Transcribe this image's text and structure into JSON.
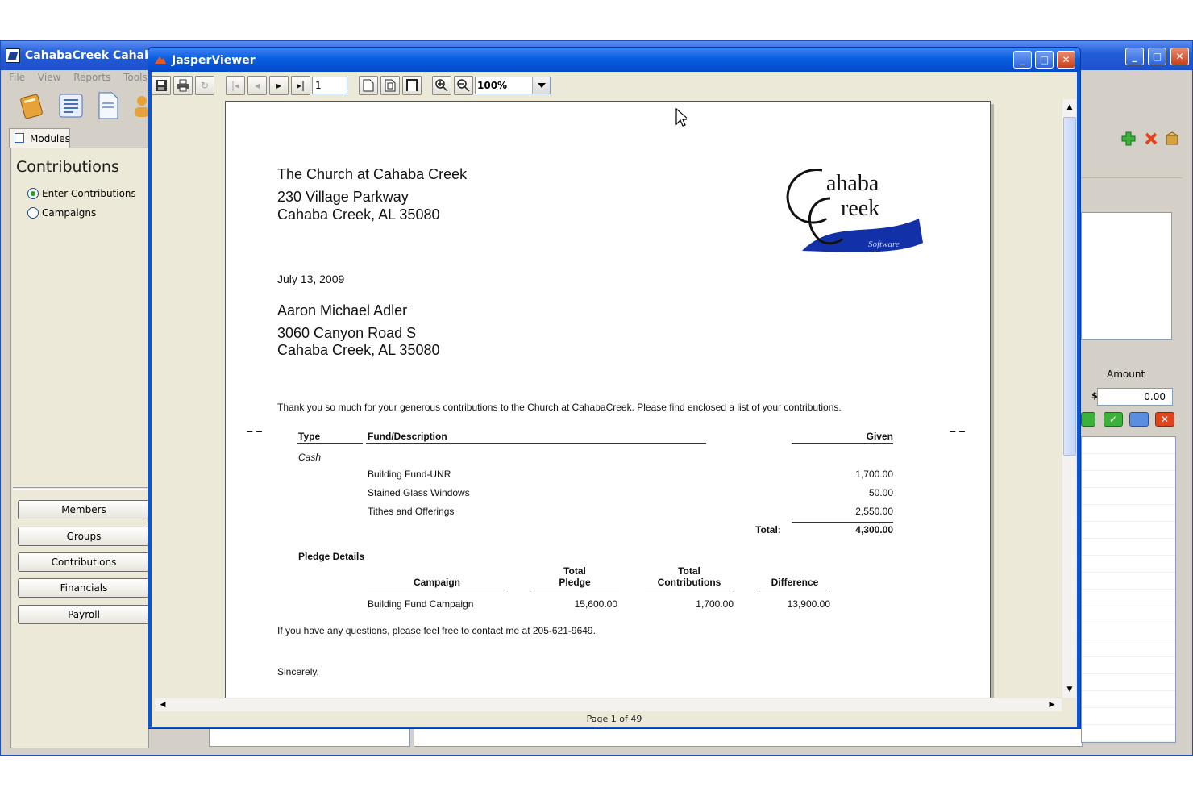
{
  "main_window": {
    "title": "CahabaCreek Cahaba",
    "menu": [
      "File",
      "View",
      "Reports",
      "Tools"
    ],
    "modules_tab": "Modules",
    "panel_heading": "Contributions",
    "radio_options": [
      {
        "label": "Enter Contributions",
        "selected": true
      },
      {
        "label": "Campaigns",
        "selected": false
      }
    ],
    "nav_buttons": [
      "Members",
      "Groups",
      "Contributions",
      "Financials",
      "Payroll"
    ],
    "right_panel": {
      "amount_label": "Amount",
      "currency_symbol": "$",
      "amount_value": "0.00"
    }
  },
  "viewer": {
    "title": "JasperViewer",
    "page_input": "1",
    "zoom": "100%",
    "status": "Page 1 of 49"
  },
  "report": {
    "church_name": "The Church at Cahaba Creek",
    "church_address1": "230 Village Parkway",
    "church_address2": "Cahaba Creek, AL 35080",
    "logo": {
      "line1": "ahaba",
      "line2": "reek",
      "tagline": "Software"
    },
    "date": "July 13, 2009",
    "recipient_name": "Aaron Michael Adler",
    "recipient_address1": "3060 Canyon Road S",
    "recipient_address2": "Cahaba Creek,  AL  35080",
    "intro": "Thank you so much for your generous contributions to the Church at CahabaCreek.  Please find enclosed a list of your contributions.",
    "table_headers": {
      "type": "Type",
      "fund": "Fund/Description",
      "given": "Given"
    },
    "cash_label": "Cash",
    "rows": [
      {
        "fund": "Building Fund-UNR",
        "given": "1,700.00"
      },
      {
        "fund": "Stained Glass Windows",
        "given": "50.00"
      },
      {
        "fund": "Tithes and Offerings",
        "given": "2,550.00"
      }
    ],
    "total_label": "Total:",
    "total_value": "4,300.00",
    "pledge_heading": "Pledge Details",
    "pledge_headers": {
      "campaign": "Campaign",
      "pledge_l1": "Total",
      "pledge_l2": "Pledge",
      "contrib_l1": "Total",
      "contrib_l2": "Contributions",
      "difference": "Difference"
    },
    "pledge_row": {
      "campaign": "Building Fund Campaign",
      "pledge": "15,600.00",
      "contributions": "1,700.00",
      "difference": "13,900.00"
    },
    "questions": "If you have any questions, please feel free to contact me at 205-621-9649.",
    "closing": "Sincerely,"
  }
}
